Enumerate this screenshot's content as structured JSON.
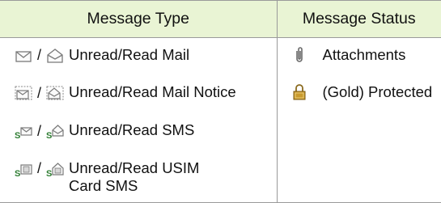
{
  "headers": {
    "type": "Message Type",
    "status": "Message Status"
  },
  "types": [
    {
      "icons": [
        "envelope-unread-icon",
        "envelope-read-icon"
      ],
      "separator": "/",
      "label": "Unread/Read Mail"
    },
    {
      "icons": [
        "mail-notice-unread-icon",
        "mail-notice-read-icon"
      ],
      "separator": "/",
      "label": "Unread/Read Mail Notice"
    },
    {
      "icons": [
        "sms-unread-icon",
        "sms-read-icon"
      ],
      "separator": "/",
      "label": "Unread/Read SMS"
    },
    {
      "icons": [
        "usim-sms-unread-icon",
        "usim-sms-read-icon"
      ],
      "separator": "/",
      "label": "Unread/Read USIM Card SMS"
    }
  ],
  "statuses": [
    {
      "icon": "paperclip-icon",
      "label": "Attachments"
    },
    {
      "icon": "padlock-icon",
      "label": "(Gold) Protected"
    }
  ],
  "colors": {
    "header_bg": "#e9f4d4",
    "border": "#9a9a9a",
    "gold": "#c99a2e"
  }
}
